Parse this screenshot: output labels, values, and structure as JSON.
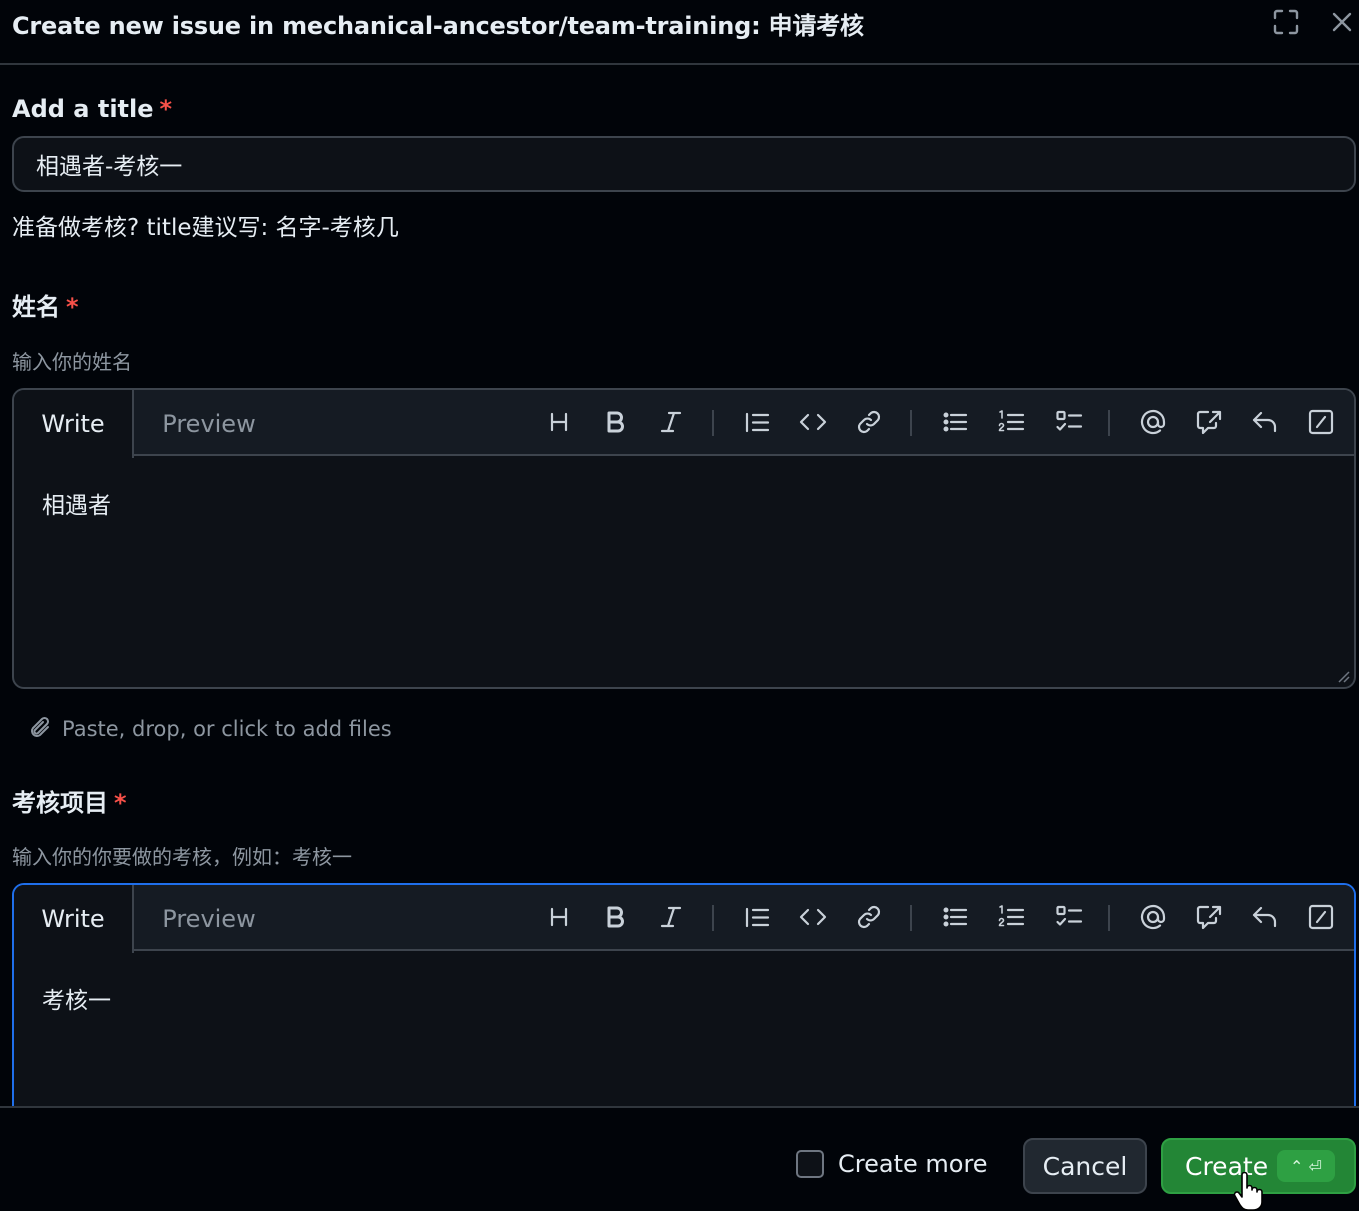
{
  "header": {
    "title": "Create new issue in mechanical-ancestor/team-training: 申请考核",
    "expand_icon": "fullscreen-icon",
    "close_icon": "close-icon"
  },
  "title_field": {
    "label": "Add a title",
    "required_mark": "*",
    "value": "相遇者-考核一",
    "hint": "准备做考核? title建议写: 名字-考核几"
  },
  "name_field": {
    "label": "姓名",
    "required_mark": "*",
    "description": "输入你的姓名",
    "tabs": {
      "write": "Write",
      "preview": "Preview"
    },
    "value": "相遇者",
    "attach_text": "Paste, drop, or click to add files"
  },
  "project_field": {
    "label": "考核项目",
    "required_mark": "*",
    "description": "输入你的你要做的考核，例如：考核一",
    "tabs": {
      "write": "Write",
      "preview": "Preview"
    },
    "value": "考核一"
  },
  "toolbar_icons": [
    "heading-icon",
    "bold-icon",
    "italic-icon",
    "quote-icon",
    "code-icon",
    "link-icon",
    "bulleted-list-icon",
    "numbered-list-icon",
    "task-list-icon",
    "mention-icon",
    "reference-icon",
    "reply-icon",
    "slash-command-icon"
  ],
  "footer": {
    "create_more_label": "Create more",
    "create_more_checked": false,
    "cancel_label": "Cancel",
    "create_label": "Create",
    "create_shortcut": "⌃ ⏎"
  },
  "colors": {
    "background": "#010409",
    "input_background": "#0d1117",
    "border": "#3d444d",
    "focus_border": "#1f6feb",
    "required": "#f85149",
    "primary_button": "#238636"
  }
}
